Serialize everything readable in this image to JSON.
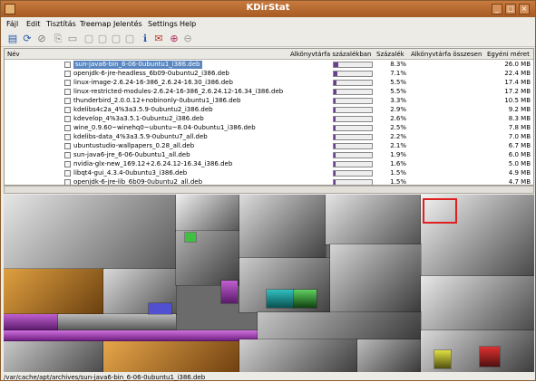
{
  "window": {
    "title": "KDirStat"
  },
  "menu": [
    "Fájl",
    "Edit",
    "Tisztítás",
    "Treemap",
    "Jelentés",
    "Settings",
    "Help"
  ],
  "toolbar_icons": [
    "open-folder-icon",
    "refresh-icon",
    "stop-icon",
    "copy-icon",
    "trash-icon",
    "blank1-icon",
    "blank2-icon",
    "blank3-icon",
    "blank4-icon",
    "info-icon",
    "mail-icon",
    "zoom-in-icon",
    "zoom-out-icon"
  ],
  "columns": {
    "name": "Név",
    "subtree_pct": "Alkönyvtárfa százalékban",
    "pct": "Százalék",
    "subtree_total": "Alkönyvtárfa összesen",
    "own_size": "Egyéni méret"
  },
  "rows": [
    {
      "name": "sun-java6-bin_6-06-0ubuntu1_i386.deb",
      "pct": "8.3%",
      "size": "26.0 MB",
      "fill": 0.083,
      "selected": true
    },
    {
      "name": "openjdk-6-jre-headless_6b09-0ubuntu2_i386.deb",
      "pct": "7.1%",
      "size": "22.4 MB",
      "fill": 0.071
    },
    {
      "name": "linux-image-2.6.24-16-386_2.6.24-16.30_i386.deb",
      "pct": "5.5%",
      "size": "17.4 MB",
      "fill": 0.055
    },
    {
      "name": "linux-restricted-modules-2.6.24-16-386_2.6.24.12-16.34_i386.deb",
      "pct": "5.5%",
      "size": "17.2 MB",
      "fill": 0.055
    },
    {
      "name": "thunderbird_2.0.0.12+nobinonly-0ubuntu1_i386.deb",
      "pct": "3.3%",
      "size": "10.5 MB",
      "fill": 0.033
    },
    {
      "name": "kdelibs4c2a_4%3a3.5.9-0ubuntu2_i386.deb",
      "pct": "2.9%",
      "size": "9.2 MB",
      "fill": 0.029
    },
    {
      "name": "kdevelop_4%3a3.5.1-0ubuntu2_i386.deb",
      "pct": "2.6%",
      "size": "8.3 MB",
      "fill": 0.026
    },
    {
      "name": "wine_0.9.60~winehq0~ubuntu~8.04-0ubuntu1_i386.deb",
      "pct": "2.5%",
      "size": "7.8 MB",
      "fill": 0.025
    },
    {
      "name": "kdelibs-data_4%3a3.5.9-0ubuntu7_all.deb",
      "pct": "2.2%",
      "size": "7.0 MB",
      "fill": 0.022
    },
    {
      "name": "ubuntustudio-wallpapers_0.28_all.deb",
      "pct": "2.1%",
      "size": "6.7 MB",
      "fill": 0.021
    },
    {
      "name": "sun-java6-jre_6-06-0ubuntu1_all.deb",
      "pct": "1.9%",
      "size": "6.0 MB",
      "fill": 0.019
    },
    {
      "name": "nvidia-glx-new_169.12+2.6.24.12-16.34_i386.deb",
      "pct": "1.6%",
      "size": "5.0 MB",
      "fill": 0.016
    },
    {
      "name": "libqt4-gui_4.3.4-0ubuntu3_i386.deb",
      "pct": "1.5%",
      "size": "4.9 MB",
      "fill": 0.015
    },
    {
      "name": "openjdk-6-jre-lib_6b09-0ubuntu2_all.deb",
      "pct": "1.5%",
      "size": "4.7 MB",
      "fill": 0.015
    }
  ],
  "status": "/var/cache/apt/archives/sun-java6-bin_6-06-0ubuntu1_i386.deb",
  "colors": {
    "titlebar": "#b8672e",
    "selection": "#5a87c0",
    "bar_fill": "#6a3f8f"
  }
}
